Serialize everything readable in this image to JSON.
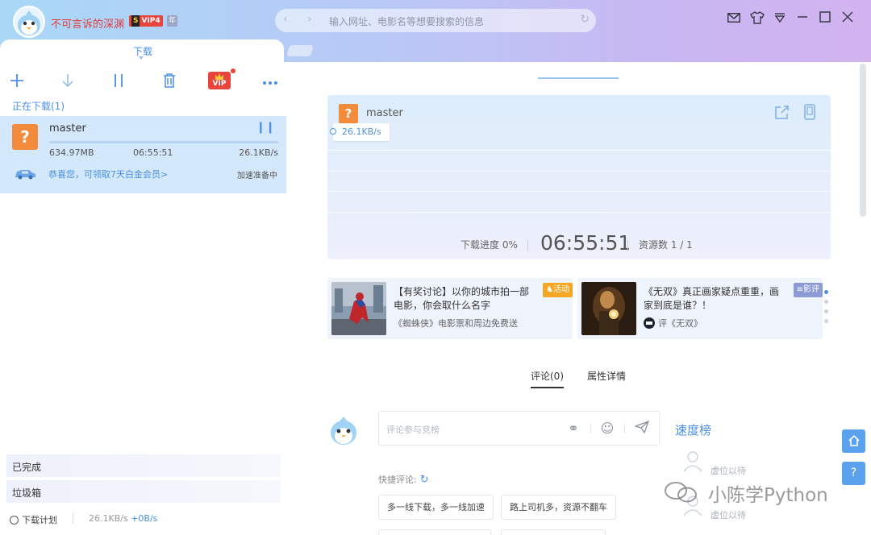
{
  "header": {
    "username": "不可言诉的深渊",
    "vip_badge_s": "S",
    "vip_badge": "VIP4",
    "year_badge": "年",
    "address_placeholder": "输入网址、电影名等想要搜索的信息",
    "active_tab": "下载"
  },
  "left": {
    "section_title": "正在下载(1)",
    "vip_tool_label": "VIP",
    "download": {
      "name": "master",
      "size": "634.97MB",
      "time": "06:55:51",
      "speed": "26.1KB/s",
      "progress": 0,
      "promo": "恭喜您，可领取7天白金会员>",
      "accel_status": "加速准备中"
    },
    "completed": "已完成",
    "trash": "垃圾箱",
    "plan": "下载计划",
    "total_speed": "26.1KB/s",
    "upload_speed": "+0B/s"
  },
  "detail": {
    "name": "master",
    "speed": "26.1KB/s",
    "progress_label": "下载进度 0%",
    "time": "06:55:51",
    "resources": "资源数 1 / 1"
  },
  "cards": [
    {
      "title": "【有奖讨论】以你的城市拍一部电影，你会取什么名字",
      "sub": "《蜘蛛侠》电影票和周边免费送",
      "tag": "活动",
      "tag_color": "#f5a623"
    },
    {
      "title": "《无双》真正画家疑点重重，画家到底是谁？！",
      "sub": "评《无双》",
      "tag": "影评",
      "tag_color": "#8c9bd6"
    }
  ],
  "tabs": {
    "comments": "评论(0)",
    "properties": "属性详情"
  },
  "comment": {
    "placeholder": "评论参与竞榜",
    "rank_title": "速度榜",
    "rank_placeholder_1": "虚位以待",
    "rank_placeholder_2": "虚位以待",
    "quick_label": "快捷评论:",
    "chips": [
      "多一线下载，多一线加速",
      "路上司机多，资源不翻车"
    ]
  },
  "watermark": "小陈学Python"
}
